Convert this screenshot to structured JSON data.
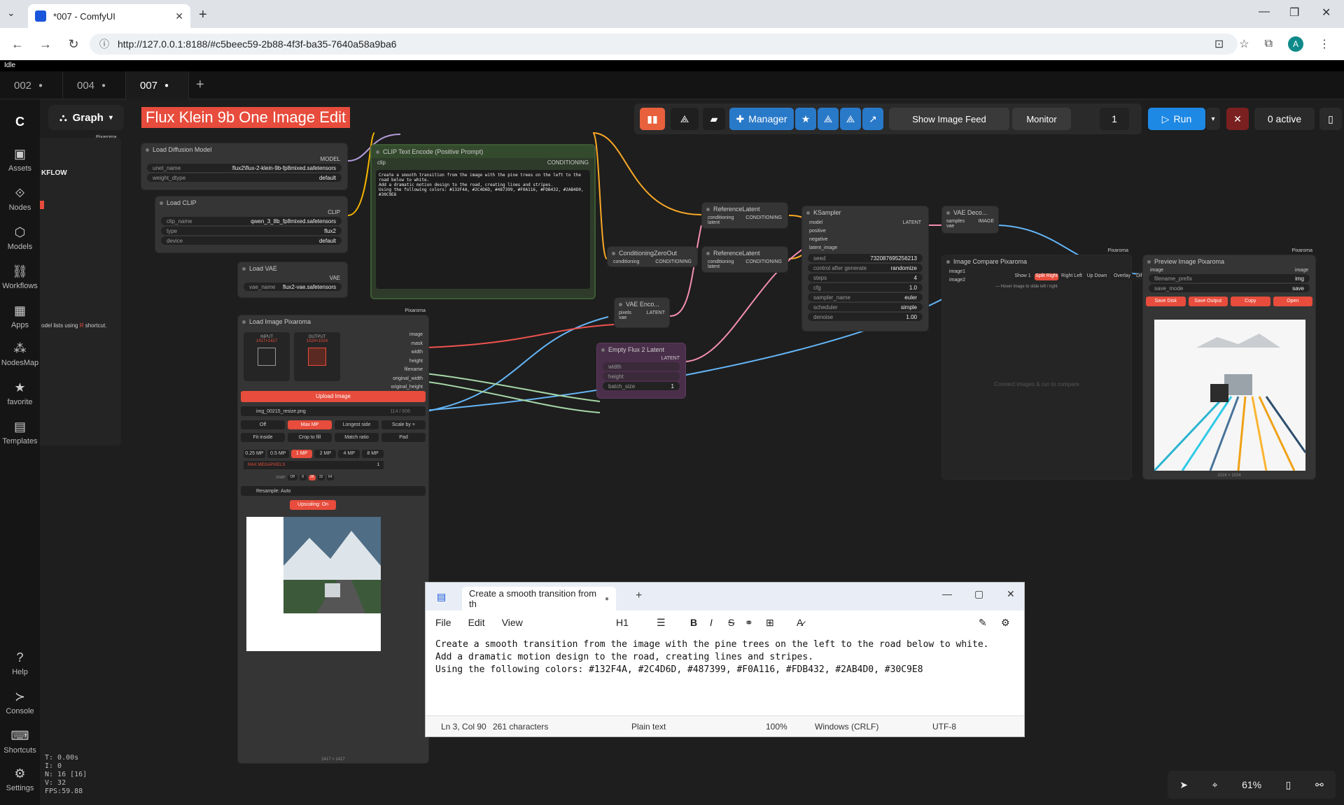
{
  "browser": {
    "tab_title": "*007 - ComfyUI",
    "url": "http://127.0.0.1:8188/#c5beec59-2b88-4f3f-ba35-7640a58a9ba6",
    "avatar_letter": "A"
  },
  "status": {
    "idle": "Idle"
  },
  "workflow_tabs": [
    {
      "label": "002",
      "dot": "●"
    },
    {
      "label": "004",
      "dot": "●"
    },
    {
      "label": "007",
      "dot": "●"
    }
  ],
  "sidebar": {
    "items": [
      {
        "label": "Assets",
        "icon": "assets-icon"
      },
      {
        "label": "Nodes",
        "icon": "nodes-icon"
      },
      {
        "label": "Models",
        "icon": "models-icon"
      },
      {
        "label": "Workflows",
        "icon": "workflows-icon"
      },
      {
        "label": "Apps",
        "icon": "apps-icon"
      },
      {
        "label": "NodesMap",
        "icon": "nodesmap-icon"
      },
      {
        "label": "favorite",
        "icon": "star-icon"
      },
      {
        "label": "Templates",
        "icon": "templates-icon"
      },
      {
        "label": "Help",
        "icon": "help-icon"
      },
      {
        "label": "Console",
        "icon": "console-icon"
      },
      {
        "label": "Shortcuts",
        "icon": "keyboard-icon"
      },
      {
        "label": "Settings",
        "icon": "gear-icon"
      }
    ]
  },
  "graph": {
    "mode_label": "Graph",
    "banner": "Flux Klein 9b One Image Edit",
    "pixaroma_tag": "Pixaroma",
    "panel_partial_title": "KFLOW",
    "panel_partial_text": "odel lists using",
    "panel_partial_key": "R",
    "panel_partial_suffix": "shortcut."
  },
  "toolbar": {
    "manager": "Manager",
    "show_image_feed": "Show Image Feed",
    "monitor": "Monitor",
    "batch_count": "1",
    "run": "Run",
    "active": "0 active"
  },
  "nodes": {
    "load_diffusion": {
      "title": "Load Diffusion Model",
      "out": "MODEL",
      "unet_name_label": "unet_name",
      "unet_name": "flux2\\flux-2-klein-9b-fp8mixed.safetensors",
      "weight_label": "weight_dtype",
      "weight": "default"
    },
    "load_clip": {
      "title": "Load CLIP",
      "out": "CLIP",
      "clip_name_label": "clip_name",
      "clip_name": "qwen_3_8b_fp8mixed.safetensors",
      "type_label": "type",
      "type": "flux2",
      "device_label": "device",
      "device": "default"
    },
    "load_vae": {
      "title": "Load VAE",
      "out": "VAE",
      "vae_label": "vae_name",
      "vae": "flux2-vae.safetensors"
    },
    "clip_text": {
      "title": "CLIP Text Encode (Positive Prompt)",
      "in": "clip",
      "out": "CONDITIONING",
      "text": "Create a smooth transition from the image with the pine trees on the left to the road below to white.\nAdd a dramatic motion design to the road, creating lines and stripes.\nUsing the following colors: #132F4A, #2C4D6D, #487399, #F0A116, #FDB432, #2AB4D0, #30C9E8"
    },
    "ref_latent_1": {
      "title": "ReferenceLatent",
      "in1": "conditioning",
      "in2": "latent",
      "out": "CONDITIONING"
    },
    "ref_latent_2": {
      "title": "ReferenceLatent",
      "in1": "conditioning",
      "in2": "latent",
      "out": "CONDITIONING"
    },
    "cond_zero": {
      "title": "ConditioningZeroOut",
      "in": "conditioning",
      "out": "CONDITIONING"
    },
    "vae_encode": {
      "title": "VAE Enco...",
      "in1": "pixels",
      "in2": "vae",
      "out": "LATENT"
    },
    "empty_latent": {
      "title": "Empty Flux 2 Latent",
      "out": "LATENT",
      "width": "width",
      "height": "height",
      "batch_label": "batch_size",
      "batch": "1"
    },
    "ksampler": {
      "title": "KSampler",
      "out": "LATENT",
      "inputs": [
        "model",
        "positive",
        "negative",
        "latent_image"
      ],
      "widgets": [
        {
          "label": "seed",
          "value": "732087695256213"
        },
        {
          "label": "control after generate",
          "value": "randomize"
        },
        {
          "label": "steps",
          "value": "4"
        },
        {
          "label": "cfg",
          "value": "1.0"
        },
        {
          "label": "sampler_name",
          "value": "euler"
        },
        {
          "label": "scheduler",
          "value": "simple"
        },
        {
          "label": "denoise",
          "value": "1.00"
        }
      ]
    },
    "vae_decode": {
      "title": "VAE Deco...",
      "in1": "samples",
      "in2": "vae",
      "out": "IMAGE"
    },
    "image_compare": {
      "title": "Image Compare Pixaroma",
      "in1": "image1",
      "in2": "image2",
      "modes": [
        "Show 1",
        "Split Right",
        "Right Left",
        "Up Down",
        "Overlay",
        "Difference"
      ],
      "hint": "— Hover image to slide left / right",
      "placeholder": "Connect images & run to compare"
    },
    "preview": {
      "title": "Preview Image Pixaroma",
      "in": "image",
      "out": "image",
      "prefix_label": "filename_prefix",
      "prefix": "img",
      "save_mode_label": "save_mode",
      "save_mode": "save",
      "buttons": [
        "Save Disk",
        "Save Output",
        "Copy",
        "Open"
      ],
      "size": "1024 × 1024"
    },
    "load_image": {
      "title": "Load Image Pixaroma",
      "outputs": [
        "image",
        "mask",
        "width",
        "height",
        "filename",
        "original_width",
        "original_height"
      ],
      "input_label": "INPUT",
      "input_size": "1417×1417",
      "output_label": "OUTPUT",
      "output_size": "1024×1024",
      "upload": "Upload Image",
      "file": "img_00215_resize.png",
      "file_count": "114 / 606",
      "modes": [
        "Off",
        "Max MP",
        "Longest side",
        "Scale by ×"
      ],
      "fits": [
        "Fit inside",
        "Crop to fill",
        "Match ratio",
        "Pad"
      ],
      "mps": [
        "0.25 MP",
        "0.5 MP",
        "1 MP",
        "2 MP",
        "4 MP",
        "8 MP"
      ],
      "max_mp_label": "MAX MEGAPIXELS",
      "max_mp": "1",
      "snap_label": "SNAP",
      "snaps": [
        "Off",
        "8",
        "16",
        "32",
        "64"
      ],
      "resample": "Resample: Auto",
      "upscaling": "Upscaling: On",
      "size": "1417 × 1417"
    }
  },
  "notepad": {
    "tab_title": "Create a smooth transition from th",
    "menus": [
      "File",
      "Edit",
      "View"
    ],
    "heading": "H1",
    "lines": [
      "Create a smooth transition from the image with the pine trees on the left to the road below to white.",
      "Add a dramatic motion design to the road, creating lines and stripes.",
      "Using the following colors: #132F4A, #2C4D6D, #487399, #F0A116, #FDB432, #2AB4D0, #30C9E8"
    ],
    "status": {
      "pos": "Ln 3, Col 90",
      "chars": "261 characters",
      "type": "Plain text",
      "zoom": "100%",
      "eol": "Windows (CRLF)",
      "enc": "UTF-8"
    }
  },
  "stats": [
    "T: 0.00s",
    "I: 0",
    "N: 16 [16]",
    "V: 32",
    "FPS:59.88"
  ],
  "zoom": {
    "level": "61%"
  },
  "colors": {
    "accent": "#e74c3c",
    "run": "#1e88e5",
    "manager": "#2979c9",
    "link_clip": "#f4b400",
    "link_cond": "#f9a825",
    "link_latent": "#f48fb1",
    "link_image": "#64b5f6",
    "link_vae": "#ef5350"
  }
}
